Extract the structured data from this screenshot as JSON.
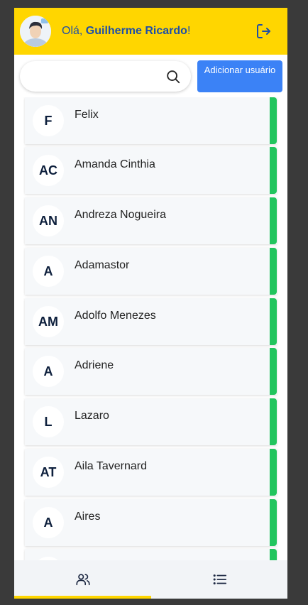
{
  "header": {
    "greeting_prefix": "Olá, ",
    "user_name": "Guilherme Ricardo",
    "greeting_suffix": "!"
  },
  "search": {
    "value": "",
    "placeholder": ""
  },
  "toolbar": {
    "add_user_label": "Adicionar usuário"
  },
  "users": [
    {
      "initials": "F",
      "name": "Felix",
      "status": "active"
    },
    {
      "initials": "AC",
      "name": "Amanda Cinthia",
      "status": "active"
    },
    {
      "initials": "AN",
      "name": "Andreza Nogueira",
      "status": "active"
    },
    {
      "initials": "A",
      "name": "Adamastor",
      "status": "active"
    },
    {
      "initials": "AM",
      "name": "Adolfo Menezes",
      "status": "active"
    },
    {
      "initials": "A",
      "name": "Adriene",
      "status": "active"
    },
    {
      "initials": "L",
      "name": "Lazaro",
      "status": "active"
    },
    {
      "initials": "AT",
      "name": "Aila Tavernard",
      "status": "active"
    },
    {
      "initials": "A",
      "name": "Aires",
      "status": "active"
    }
  ],
  "nav": {
    "items": [
      {
        "icon": "users-icon",
        "active": true
      },
      {
        "icon": "list-icon",
        "active": false
      }
    ]
  },
  "colors": {
    "header_background": "#ffd600",
    "accent_blue": "#1e4fa8",
    "button_blue": "#3b82f6",
    "status_green": "#22c55e",
    "card_background": "#f6f8fa",
    "initials_text": "#0d1f3c"
  }
}
